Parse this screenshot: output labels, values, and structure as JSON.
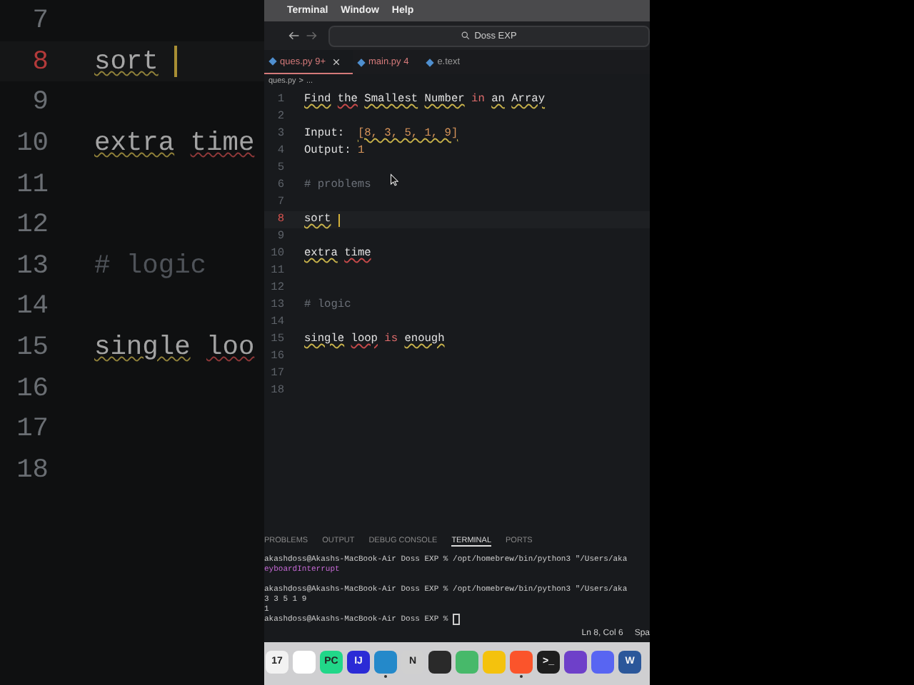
{
  "zoomed_editor": {
    "lines": [
      {
        "number": "7",
        "active": false
      },
      {
        "number": "8",
        "active": true,
        "segments": [
          {
            "text": "sort",
            "kind": "flagged"
          }
        ]
      },
      {
        "number": "9",
        "active": false
      },
      {
        "number": "10",
        "active": false,
        "segments": [
          {
            "text": "extra",
            "kind": "flagged"
          },
          {
            "text": "time",
            "kind": "misspelled"
          }
        ]
      },
      {
        "number": "11",
        "active": false
      },
      {
        "number": "12",
        "active": false
      },
      {
        "number": "13",
        "active": false,
        "segments": [
          {
            "text": "# logic",
            "kind": "comment"
          }
        ]
      },
      {
        "number": "14",
        "active": false
      },
      {
        "number": "15",
        "active": false,
        "segments": [
          {
            "text": "single",
            "kind": "flagged"
          },
          {
            "text": "loo",
            "kind": "misspelled"
          }
        ]
      },
      {
        "number": "16",
        "active": false
      },
      {
        "number": "17",
        "active": false
      },
      {
        "number": "18",
        "active": false
      }
    ]
  },
  "menu_bar": [
    "Terminal",
    "Window",
    "Help"
  ],
  "title_bar": {
    "search": "Doss EXP"
  },
  "tabs": [
    {
      "label": "ques.py",
      "badge": "9+",
      "selected": true,
      "dirty": true
    },
    {
      "label": "main.py",
      "badge": "4",
      "selected": false,
      "dirty": true
    },
    {
      "label": "e.text",
      "selected": false,
      "dirty": false
    }
  ],
  "breadcrumb": [
    "ques.py",
    ">",
    "..."
  ],
  "editor": {
    "lines": [
      {
        "number": "1",
        "active": false,
        "cursor": false,
        "segments": [
          {
            "text": "Find",
            "kind": "flagged"
          },
          {
            "text": "the",
            "kind": "misspelled"
          },
          {
            "text": "Smallest",
            "kind": "flagged"
          },
          {
            "text": "Number",
            "kind": "flagged"
          },
          {
            "text": "in",
            "kind": "keyword"
          },
          {
            "text": "an",
            "kind": "flagged"
          },
          {
            "text": "Array",
            "kind": "flagged"
          }
        ]
      },
      {
        "number": "2",
        "active": false,
        "cursor": false
      },
      {
        "number": "3",
        "active": false,
        "cursor": false,
        "segments": [
          {
            "text": "Input: ",
            "kind": "plain"
          },
          {
            "text": "[8, 3, 5, 1, 9]",
            "kind": "flaggednumber"
          }
        ]
      },
      {
        "number": "4",
        "active": false,
        "cursor": false,
        "segments": [
          {
            "text": "Output:",
            "kind": "plain"
          },
          {
            "text": "1",
            "kind": "number"
          }
        ]
      },
      {
        "number": "5",
        "active": false,
        "cursor": false
      },
      {
        "number": "6",
        "active": false,
        "cursor": false,
        "segments": [
          {
            "text": "# problems",
            "kind": "comment"
          }
        ]
      },
      {
        "number": "7",
        "active": false,
        "cursor": false
      },
      {
        "number": "8",
        "active": true,
        "cursor": true,
        "segments": [
          {
            "text": "sort",
            "kind": "flagged"
          }
        ]
      },
      {
        "number": "9",
        "active": false,
        "cursor": false
      },
      {
        "number": "10",
        "active": false,
        "cursor": false,
        "segments": [
          {
            "text": "extra",
            "kind": "flagged"
          },
          {
            "text": "time",
            "kind": "misspelled"
          }
        ]
      },
      {
        "number": "11",
        "active": false,
        "cursor": false
      },
      {
        "number": "12",
        "active": false,
        "cursor": false
      },
      {
        "number": "13",
        "active": false,
        "cursor": false,
        "segments": [
          {
            "text": "# logic",
            "kind": "comment"
          }
        ]
      },
      {
        "number": "14",
        "active": false,
        "cursor": false
      },
      {
        "number": "15",
        "active": false,
        "cursor": false,
        "segments": [
          {
            "text": "single",
            "kind": "flagged"
          },
          {
            "text": "loop",
            "kind": "misspelled"
          },
          {
            "text": "is",
            "kind": "keyword"
          },
          {
            "text": "enough",
            "kind": "flagged"
          }
        ]
      },
      {
        "number": "16",
        "active": false,
        "cursor": false
      },
      {
        "number": "17",
        "active": false,
        "cursor": false
      },
      {
        "number": "18",
        "active": false,
        "cursor": false
      }
    ]
  },
  "panel_tabs": [
    {
      "label": "PROBLEMS",
      "selected": false
    },
    {
      "label": "OUTPUT",
      "selected": false
    },
    {
      "label": "DEBUG CONSOLE",
      "selected": false
    },
    {
      "label": "TERMINAL",
      "selected": true
    },
    {
      "label": "PORTS",
      "selected": false
    }
  ],
  "terminal": [
    {
      "text": "akashdoss@Akashs-MacBook-Air Doss EXP % /opt/homebrew/bin/python3 \"/Users/aka",
      "kind": "plain",
      "cursor": false
    },
    {
      "text": "eyboardInterrupt",
      "kind": "error",
      "cursor": false
    },
    {
      "kind": "blank",
      "cursor": false
    },
    {
      "text": "akashdoss@Akashs-MacBook-Air Doss EXP % /opt/homebrew/bin/python3 \"/Users/aka",
      "kind": "plain",
      "cursor": false
    },
    {
      "text": "3 3 5 1 9",
      "kind": "plain",
      "cursor": false
    },
    {
      "text": "1",
      "kind": "plain",
      "cursor": false
    },
    {
      "text": "akashdoss@Akashs-MacBook-Air Doss EXP %",
      "kind": "plain",
      "cursor": true
    }
  ],
  "status_bar": {
    "position": "Ln 8, Col 6",
    "indent": "Spa"
  },
  "dock": [
    {
      "label": "17",
      "color": "#f2f2f2",
      "running": false
    },
    {
      "color": "#ffffff",
      "running": false
    },
    {
      "label": "PC",
      "color": "#21d789",
      "running": false
    },
    {
      "label": "IJ",
      "color": "#2b2bd6",
      "running": false
    },
    {
      "color": "#2489ca",
      "running": true
    },
    {
      "label": "N",
      "color": "#d0d0d0",
      "running": false
    },
    {
      "color": "#2a2a2a",
      "running": false
    },
    {
      "color": "#47b96a",
      "running": false
    },
    {
      "color": "#f4c20d",
      "running": false
    },
    {
      "color": "#fb542b",
      "running": true
    },
    {
      "label": ">_",
      "color": "#1e1e1e",
      "running": false
    },
    {
      "color": "#6e40c9",
      "running": false
    },
    {
      "color": "#5865f2",
      "running": false
    },
    {
      "label": "W",
      "color": "#2b579a",
      "running": false
    }
  ]
}
